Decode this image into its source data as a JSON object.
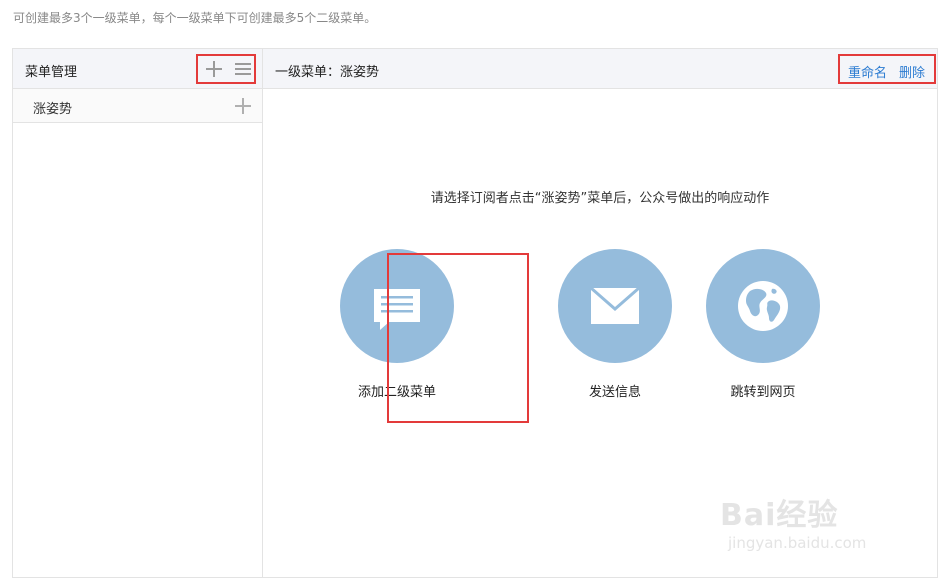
{
  "hint": "可创建最多3个一级菜单，每个一级菜单下可创建最多5个二级菜单。",
  "left_panel": {
    "title": "菜单管理",
    "items": [
      {
        "label": "涨姿势"
      }
    ]
  },
  "right_panel": {
    "title": "一级菜单：涨姿势",
    "rename_label": "重命名",
    "delete_label": "删除",
    "prompt": "请选择订阅者点击“涨姿势”菜单后，公众号做出的响应动作",
    "options": [
      {
        "label": "添加二级菜单",
        "icon": "message-icon"
      },
      {
        "label": "发送信息",
        "icon": "envelope-icon"
      },
      {
        "label": "跳转到网页",
        "icon": "globe-icon"
      }
    ]
  },
  "watermark": {
    "main": "Bai经验",
    "sub": "jingyan.baidu.com"
  },
  "colors": {
    "circle": "#95bcdc",
    "highlight": "#e33a3a",
    "link": "#2b7bd1"
  }
}
